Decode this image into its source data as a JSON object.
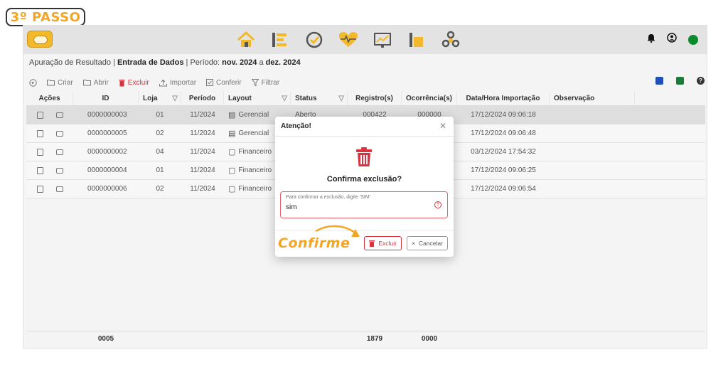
{
  "step_label": "3º PASSO",
  "icons": {
    "logo": "fsm-logo",
    "modules": [
      "home-icon",
      "list-icon",
      "check-circle-icon",
      "heart-pulse-icon",
      "chart-icon",
      "bar-chart-icon",
      "settings-cluster-icon"
    ],
    "top_right": [
      "bell-icon",
      "user-icon",
      "status-dot"
    ]
  },
  "colors": {
    "accent": "#f5a524",
    "danger": "#d9333f",
    "status_online": "#0b8a2e"
  },
  "breadcrumb": {
    "prefix": "Apuração de Resultado | ",
    "section": "Entrada de Dados",
    "period_prefix": " | Período: ",
    "period_from": "nov. 2024",
    "period_sep": " a ",
    "period_to": "dez. 2024"
  },
  "toolbar": {
    "criar": "Criar",
    "abrir": "Abrir",
    "excluir": "Excluir",
    "importar": "Importar",
    "conferir": "Conferir",
    "filtrar": "Filtrar"
  },
  "table": {
    "headers": {
      "acoes": "Ações",
      "id": "ID",
      "loja": "Loja",
      "periodo": "Período",
      "layout": "Layout",
      "status": "Status",
      "registros": "Registro(s)",
      "ocorrencias": "Ocorrência(s)",
      "data_hora": "Data/Hora Importação",
      "observacao": "Observação"
    },
    "rows": [
      {
        "id": "0000000003",
        "loja": "01",
        "periodo": "11/2024",
        "layout": "Gerencial",
        "status": "Aberto",
        "registros": "000422",
        "ocorrencias": "000000",
        "data_hora": "17/12/2024 09:06:18"
      },
      {
        "id": "0000000005",
        "loja": "02",
        "periodo": "11/2024",
        "layout": "Gerencial",
        "status": "",
        "registros": "",
        "ocorrencias": "",
        "data_hora": "17/12/2024 09:06:48"
      },
      {
        "id": "0000000002",
        "loja": "04",
        "periodo": "11/2024",
        "layout": "Financeiro",
        "status": "",
        "registros": "",
        "ocorrencias": "",
        "data_hora": "03/12/2024 17:54:32"
      },
      {
        "id": "0000000004",
        "loja": "01",
        "periodo": "11/2024",
        "layout": "Financeiro",
        "status": "",
        "registros": "",
        "ocorrencias": "",
        "data_hora": "17/12/2024 09:06:25"
      },
      {
        "id": "0000000006",
        "loja": "02",
        "periodo": "11/2024",
        "layout": "Financeiro",
        "status": "",
        "registros": "",
        "ocorrencias": "",
        "data_hora": "17/12/2024 09:06:54"
      }
    ],
    "footer": {
      "count": "0005",
      "registros_total": "1879",
      "ocorrencias_total": "0000"
    }
  },
  "modal": {
    "title": "Atenção!",
    "question": "Confirma exclusão?",
    "field_label": "Para confirmar a exclusão, digite 'SIM'",
    "field_value": "sim",
    "delete_label": "Excluir",
    "cancel_label": "Cancelar"
  },
  "annotation": "Confirme"
}
